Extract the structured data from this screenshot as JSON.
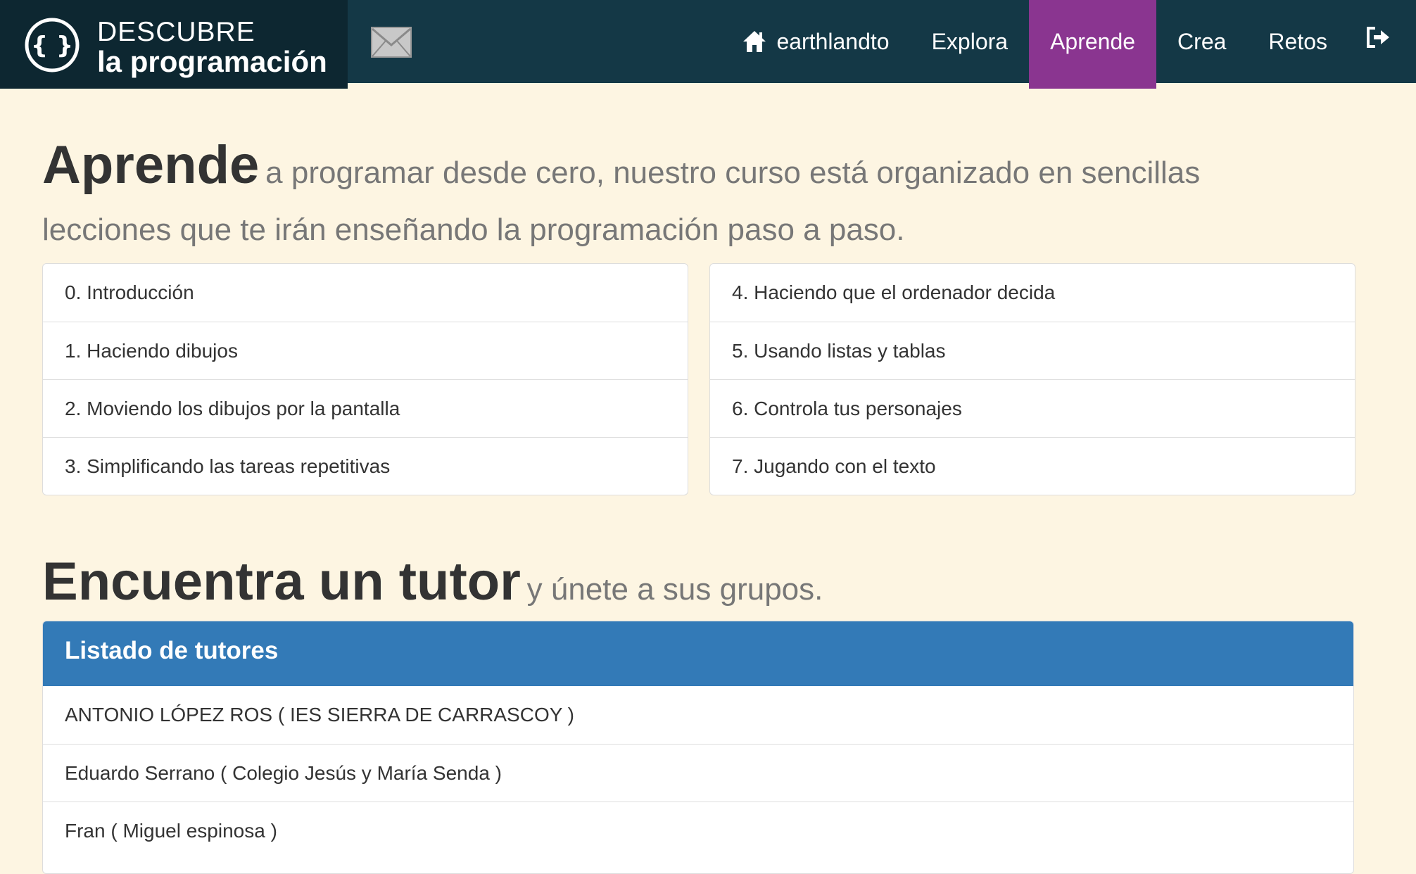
{
  "brand": {
    "line1": "DESCUBRE",
    "line2": "la programación",
    "icon": "curly-braces-logo-icon"
  },
  "nav": {
    "mail_icon": "envelope-icon",
    "user": "earthlandto",
    "user_icon": "home-icon",
    "items": [
      "Explora",
      "Aprende",
      "Crea",
      "Retos"
    ],
    "active": "Aprende",
    "logout_icon": "sign-out-icon",
    "active_color": "#8a3590"
  },
  "learn": {
    "title": "Aprende",
    "subtitle": "a programar desde cero, nuestro curso está organizado en sencillas lecciones que te irán enseñando la programación paso a paso.",
    "lessons_left": [
      "0. Introducción",
      "1. Haciendo dibujos",
      "2. Moviendo los dibujos por la pantalla",
      "3. Simplificando las tareas repetitivas"
    ],
    "lessons_right": [
      "4. Haciendo que el ordenador decida",
      "5. Usando listas y tablas",
      "6. Controla tus personajes",
      "7. Jugando con el texto"
    ]
  },
  "tutors": {
    "title": "Encuentra un tutor",
    "subtitle": "y únete a sus grupos.",
    "panel_title": "Listado de tutores",
    "panel_color": "#337ab7",
    "list": [
      "ANTONIO LÓPEZ ROS ( IES SIERRA DE CARRASCOY )",
      "Eduardo Serrano ( Colegio Jesús y María Senda )",
      "Fran ( Miguel espinosa )"
    ]
  }
}
